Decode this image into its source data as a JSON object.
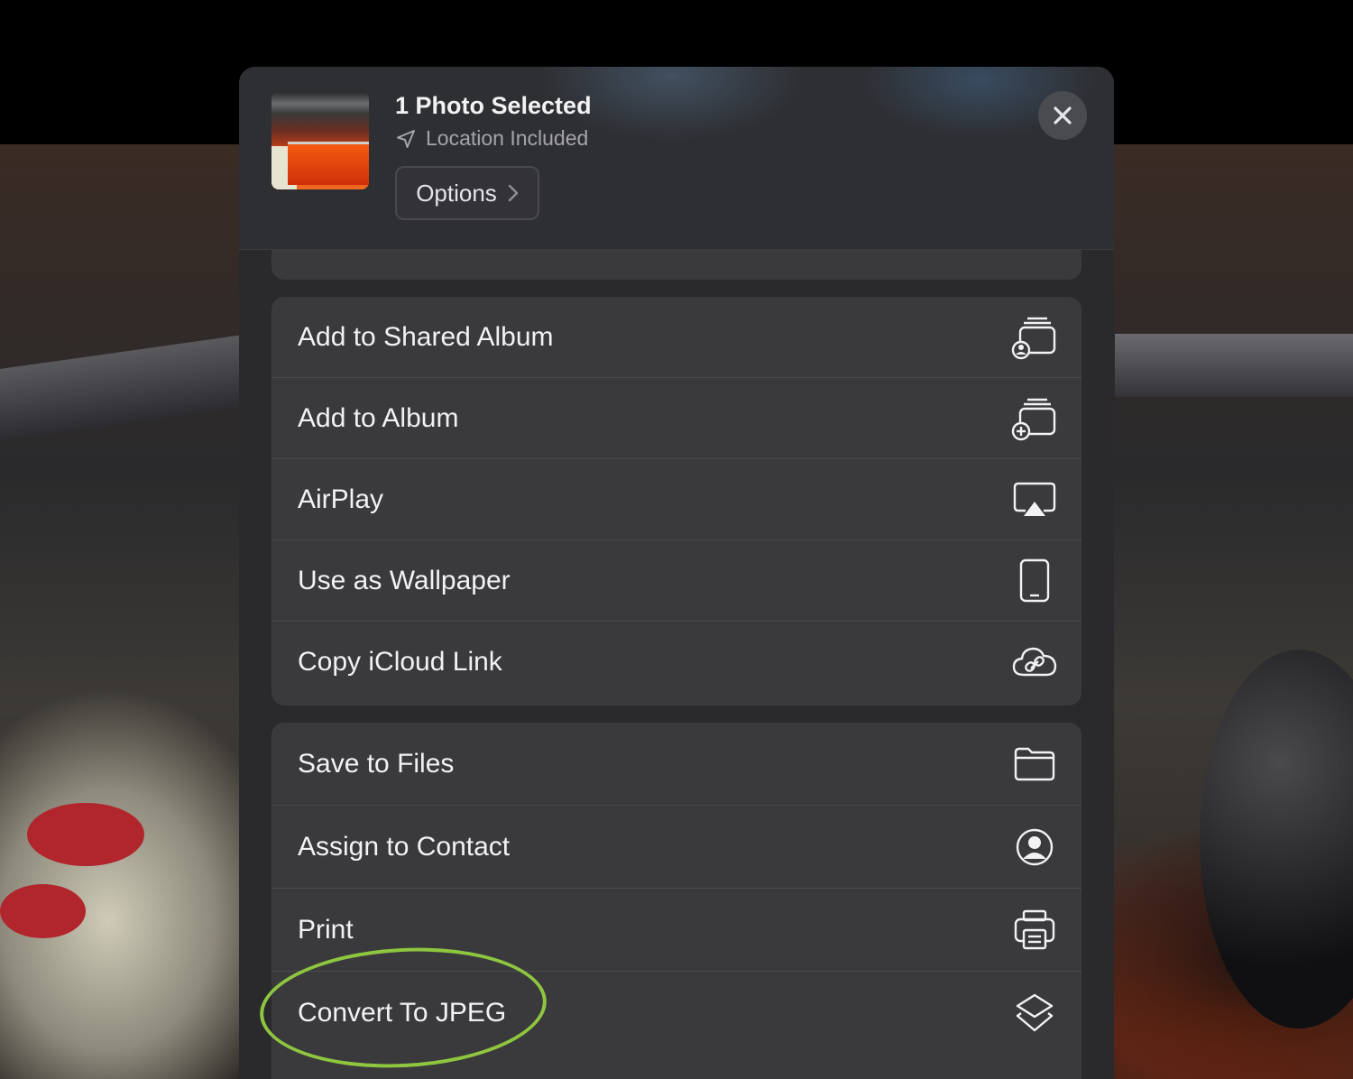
{
  "header": {
    "title": "1 Photo Selected",
    "subtitle": "Location Included",
    "options_label": "Options"
  },
  "groups": [
    {
      "items": [
        {
          "label": "Add to Shared Album",
          "icon": "shared-album-icon"
        },
        {
          "label": "Add to Album",
          "icon": "add-album-icon"
        },
        {
          "label": "AirPlay",
          "icon": "airplay-icon"
        },
        {
          "label": "Use as Wallpaper",
          "icon": "phone-icon"
        },
        {
          "label": "Copy iCloud Link",
          "icon": "icloud-link-icon"
        }
      ]
    },
    {
      "items": [
        {
          "label": "Save to Files",
          "icon": "folder-icon"
        },
        {
          "label": "Assign to Contact",
          "icon": "contact-icon"
        },
        {
          "label": "Print",
          "icon": "printer-icon"
        },
        {
          "label": "Convert To JPEG",
          "icon": "layers-icon"
        }
      ]
    }
  ],
  "colors": {
    "sheet_bg": "#2a2a2c",
    "row_bg": "#3a3a3c",
    "text": "#f2f2f4",
    "highlight": "#8fc63f"
  }
}
